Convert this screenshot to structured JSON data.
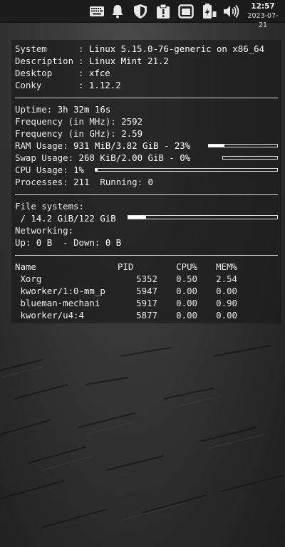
{
  "panel": {
    "icons": [
      "keyboard-icon",
      "notification-bell-icon",
      "shield-icon",
      "update-manager-icon",
      "window-icon",
      "battery-icon",
      "volume-icon"
    ],
    "clock": {
      "time": "12:57",
      "date": "2023-07-21"
    }
  },
  "conky": {
    "system": {
      "label": "System",
      "value": "Linux 5.15.0-76-generic on x86_64"
    },
    "description": {
      "label": "Description",
      "value": "Linux Mint 21.2"
    },
    "desktop": {
      "label": "Desktop",
      "value": "xfce"
    },
    "conky": {
      "label": "Conky",
      "value": "1.12.2"
    },
    "uptime": {
      "label": "Uptime:",
      "value": "3h 32m 16s"
    },
    "freq_mhz": {
      "label": "Frequency (in MHz):",
      "value": "2592"
    },
    "freq_ghz": {
      "label": "Frequency (in GHz):",
      "value": "2.59"
    },
    "ram": {
      "label": "RAM Usage:",
      "value": "931 MiB/3.82 GiB - 23%",
      "percent": 23
    },
    "swap": {
      "label": "Swap Usage:",
      "value": "268 KiB/2.00 GiB - 0%",
      "percent": 0
    },
    "cpu": {
      "label": "CPU Usage:",
      "value": "1%",
      "percent": 1
    },
    "processes": {
      "label": "Processes:",
      "value": "211",
      "running_label": "Running:",
      "running_value": "0"
    },
    "filesystems": {
      "label": "File systems:",
      "value": " / 14.2 GiB/122 GiB",
      "percent": 12
    },
    "networking": {
      "label": "Networking:",
      "up_label": "Up:",
      "up_value": "0 B",
      "down_label": " - Down:",
      "down_value": "0 B"
    },
    "table": {
      "headers": {
        "name": "Name",
        "pid": "PID",
        "cpu": "CPU%",
        "mem": "MEM%"
      },
      "rows": [
        {
          "name": " Xorg",
          "pid": "5352",
          "cpu": "0.50",
          "mem": "2.54"
        },
        {
          "name": " kworker/1:0-mm_p",
          "pid": "5947",
          "cpu": "0.00",
          "mem": "0.00"
        },
        {
          "name": " blueman-mechani",
          "pid": "5917",
          "cpu": "0.00",
          "mem": "0.90"
        },
        {
          "name": " kworker/u4:4",
          "pid": "5877",
          "cpu": "0.00",
          "mem": "0.00"
        }
      ]
    }
  }
}
